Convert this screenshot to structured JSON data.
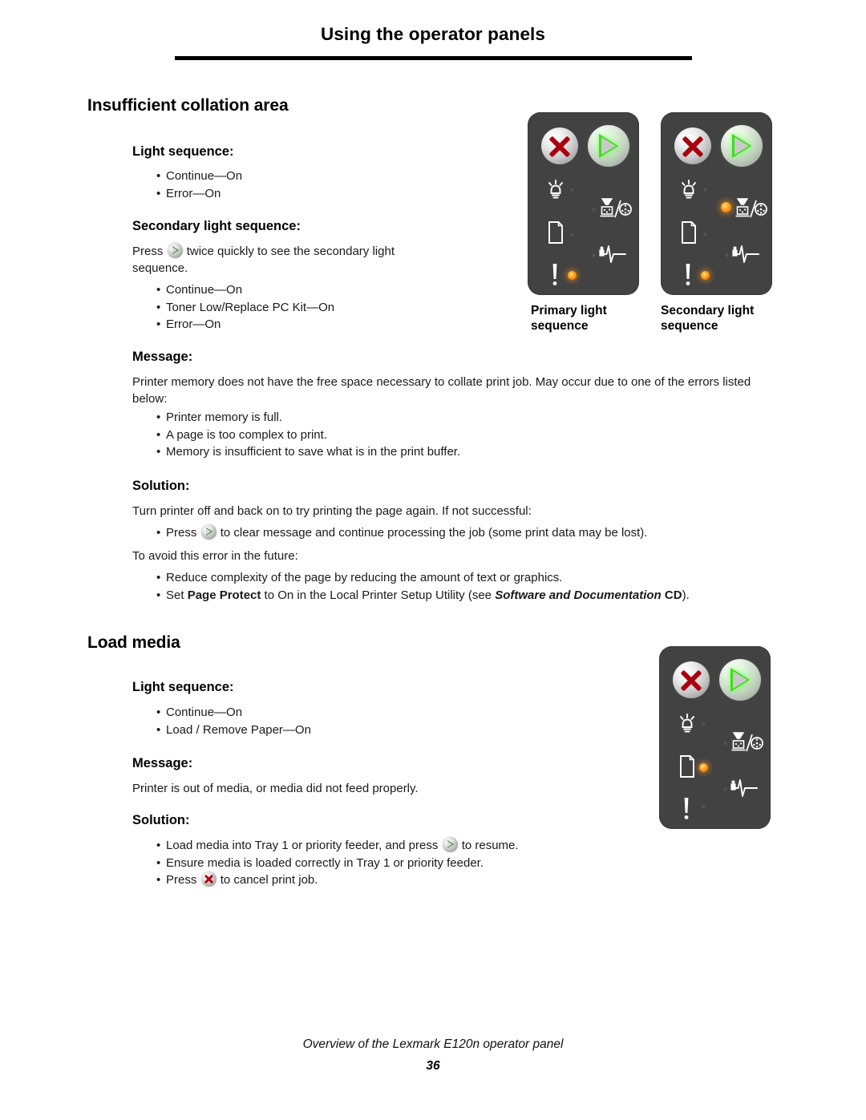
{
  "header": {
    "title": "Using the operator panels"
  },
  "sections": [
    {
      "title": "Insufficient collation area",
      "light_sequence_heading": "Light sequence:",
      "light_sequence_items": [
        "Continue—On",
        "Error—On"
      ],
      "secondary_heading": "Secondary light sequence:",
      "secondary_intro_before": "Press",
      "secondary_intro_after": "twice quickly to see the secondary light sequence.",
      "secondary_items": [
        "Continue—On",
        "Toner Low/Replace PC Kit—On",
        "Error—On"
      ],
      "message_heading": "Message:",
      "message_body": "Printer memory does not have the free space necessary to collate print job. May occur due to one of the errors listed below:",
      "message_items": [
        "Printer memory is full.",
        "A page is too complex to print.",
        "Memory is insufficient to save what is in the print buffer."
      ],
      "solution_heading": "Solution:",
      "solution_intro": "Turn printer off and back on to try printing the page again. If not successful:",
      "solution_item1_before": "Press",
      "solution_item1_after": "to clear message and continue processing the job (some print data may be lost).",
      "solution_mid": "To avoid this error in the future:",
      "solution_item2": "Reduce complexity of the page by reducing the amount of text or graphics.",
      "solution_item3": {
        "part1": "Set ",
        "bold1": "Page Protect",
        "part2": " to On in the Local Printer Setup Utility (see ",
        "bolditalic": "Software and Documentation",
        "bold2": " CD",
        "part3": ")."
      }
    },
    {
      "title": "Load media",
      "light_sequence_heading": "Light sequence:",
      "light_sequence_items": [
        "Continue—On",
        "Load / Remove Paper—On"
      ],
      "message_heading": "Message:",
      "message_body": "Printer is out of media, or media did not feed properly.",
      "solution_heading": "Solution:",
      "solution_item1_before": "Load media into Tray 1 or priority feeder, and press",
      "solution_item1_after": "to resume.",
      "solution_item2": "Ensure media is loaded correctly in Tray 1 or priority feeder.",
      "solution_item3_before": "Press",
      "solution_item3_after": "to cancel print job."
    }
  ],
  "panels": {
    "primary_caption_line1": "Primary light",
    "primary_caption_line2": "sequence",
    "secondary_caption_line1": "Secondary light",
    "secondary_caption_line2": "sequence",
    "icon_names": {
      "cancel": "cancel-button-icon",
      "continue": "continue-button-icon",
      "ready": "ready-lamp-icon",
      "toner": "toner-low-replace-pc-kit-icon",
      "paper": "load-remove-paper-icon",
      "jam": "paper-jam-icon",
      "error": "error-exclamation-icon"
    },
    "states": {
      "primary": {
        "ready": "off",
        "toner": "off",
        "paper": "off",
        "jam": "off",
        "error": "on"
      },
      "secondary": {
        "ready": "off",
        "toner": "on",
        "paper": "off",
        "jam": "off",
        "error": "on"
      },
      "loadmedia": {
        "ready": "off",
        "toner": "off",
        "paper": "on",
        "jam": "off",
        "error": "off"
      }
    }
  },
  "colors": {
    "panel_background": "#424242",
    "led_on": "#ff9a1f",
    "led_off": "#555555",
    "continue_green": "#3fdb1e",
    "cancel_red": "#a8000f",
    "page_background": "#ffffff"
  },
  "footer": {
    "note": "Overview of the Lexmark E120n operator panel",
    "page_number": "36"
  }
}
